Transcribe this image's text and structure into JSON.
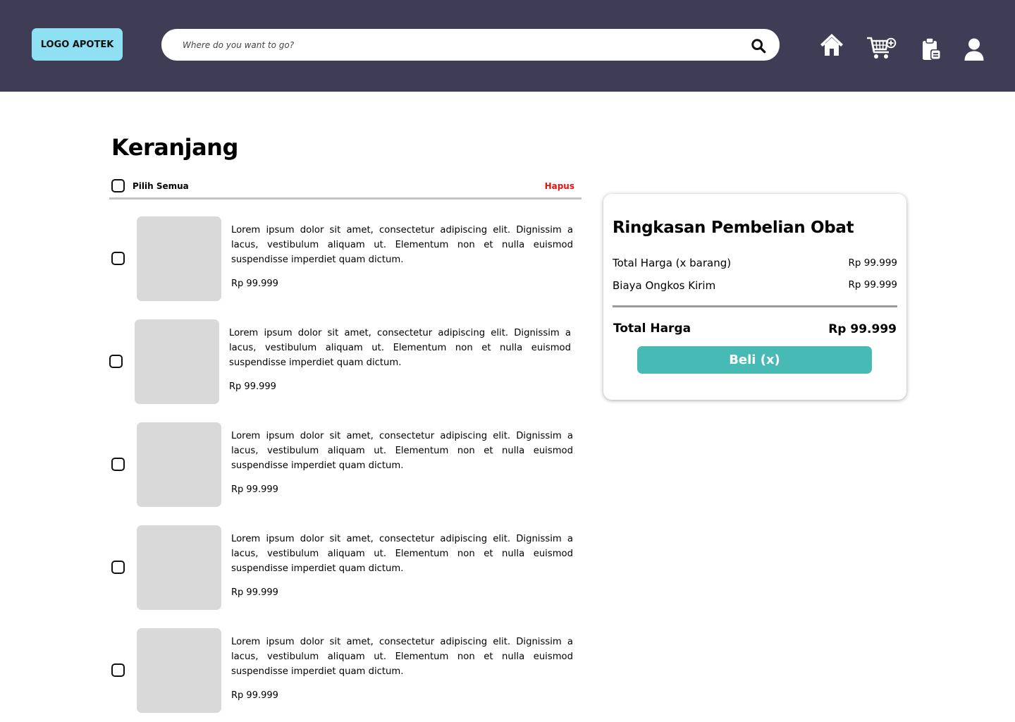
{
  "header": {
    "logo": "LOGO APOTEK",
    "search": {
      "placeholder": "Where do you want to go?",
      "value": ""
    },
    "nav_icons": [
      "home-icon",
      "cart-add-icon",
      "clipboard-icon",
      "user-icon"
    ]
  },
  "page": {
    "title": "Keranjang"
  },
  "cart": {
    "select_all_label": "Pilih Semua",
    "delete_label": "Hapus",
    "items": [
      {
        "description": "Lorem ipsum dolor sit amet, consectetur adipiscing elit. Dignissim a lacus, vestibulum aliquam ut. Elementum non et nulla euismod suspendisse imperdiet quam dictum.",
        "price": "Rp 99.999",
        "checked": false
      },
      {
        "description": "Lorem ipsum dolor sit amet, consectetur adipiscing elit. Dignissim a lacus, vestibulum aliquam ut. Elementum non et nulla euismod suspendisse imperdiet quam dictum.",
        "price": "Rp 99.999",
        "checked": false
      },
      {
        "description": "Lorem ipsum dolor sit amet, consectetur adipiscing elit. Dignissim a lacus, vestibulum aliquam ut. Elementum non et nulla euismod suspendisse imperdiet quam dictum.",
        "price": "Rp 99.999",
        "checked": false
      },
      {
        "description": "Lorem ipsum dolor sit amet, consectetur adipiscing elit. Dignissim a lacus, vestibulum aliquam ut. Elementum non et nulla euismod suspendisse imperdiet quam dictum.",
        "price": "Rp 99.999",
        "checked": false
      },
      {
        "description": "Lorem ipsum dolor sit amet, consectetur adipiscing elit. Dignissim a lacus, vestibulum aliquam ut. Elementum non et nulla euismod suspendisse imperdiet quam dictum.",
        "price": "Rp 99.999",
        "checked": false
      }
    ]
  },
  "summary": {
    "title": "Ringkasan Pembelian Obat",
    "rows": [
      {
        "label": "Total Harga (x barang)",
        "value": "Rp 99.999"
      },
      {
        "label": "Biaya Ongkos Kirim",
        "value": "Rp 99.999"
      }
    ],
    "total_label": "Total Harga",
    "total_value": "Rp 99.999",
    "buy_label": "Beli (x)"
  },
  "colors": {
    "header_bg": "#3f3d56",
    "logo_bg": "#8ee0f2",
    "accent": "#48bab6",
    "danger": "#e11313",
    "placeholder_bg": "#d9d9d9"
  }
}
